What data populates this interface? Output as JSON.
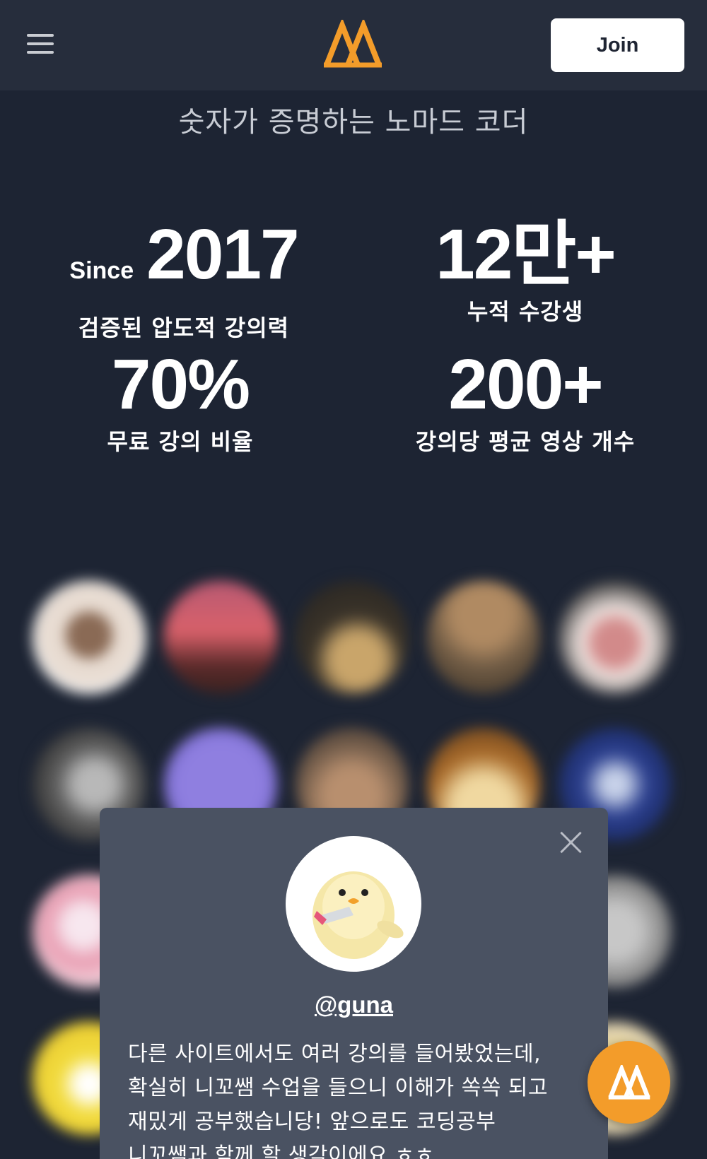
{
  "header": {
    "join_label": "Join",
    "menu_icon": "hamburger-icon",
    "logo_icon": "nomad-logo-icon",
    "brand_color": "#f39c2a"
  },
  "subtitle": "숫자가 증명하는 노마드 코더",
  "stats": [
    {
      "prefix": "Since",
      "number": "2017",
      "label": "검증된 압도적 강의력"
    },
    {
      "number": "12만+",
      "label": "누적 수강생"
    },
    {
      "number": "70%",
      "label": "무료 강의 비율"
    },
    {
      "number": "200+",
      "label": "강의당 평균 영상 개수"
    }
  ],
  "review": {
    "username": "@guna",
    "avatar_icon": "chick-avatar-icon",
    "lines": [
      "다른 사이트에서도 여러 강의를 들어봤었는데,",
      "확실히 니꼬쌤 수업을 들으니 이해가 쏙쏙 되고",
      "재밌게 공부했습니당! 앞으로도 코딩공부",
      "니꼬쌤과 함께 할 생각이에요 ㅎㅎ"
    ],
    "close_icon": "close-icon"
  },
  "fab_icon": "chat-logo-icon"
}
